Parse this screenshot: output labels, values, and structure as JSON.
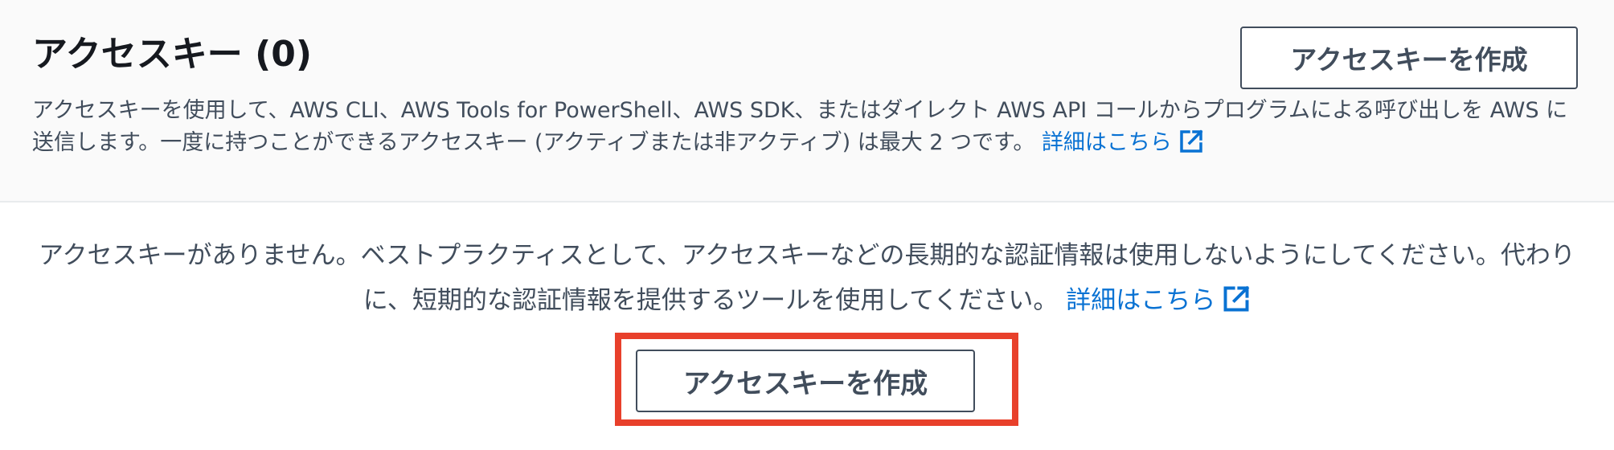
{
  "header": {
    "title": "アクセスキー (0)",
    "create_button_label": "アクセスキーを作成",
    "description": "アクセスキーを使用して、AWS CLI、AWS Tools for PowerShell、AWS SDK、またはダイレクト AWS API コールからプログラムによる呼び出しを AWS に送信します。一度に持つことができるアクセスキー (アクティブまたは非アクティブ) は最大 2 つです。",
    "learn_more_label": "詳細はこちら"
  },
  "empty_state": {
    "message": "アクセスキーがありません。ベストプラクティスとして、アクセスキーなどの長期的な認証情報は使用しないようにしてください。代わりに、短期的な認証情報を提供するツールを使用してください。",
    "learn_more_label": "詳細はこちら",
    "create_button_label": "アクセスキーを作成"
  },
  "icons": {
    "external_link": "external-link-icon"
  },
  "colors": {
    "link": "#0972d3",
    "highlight": "#e8402b",
    "button_border": "#414d5c"
  }
}
